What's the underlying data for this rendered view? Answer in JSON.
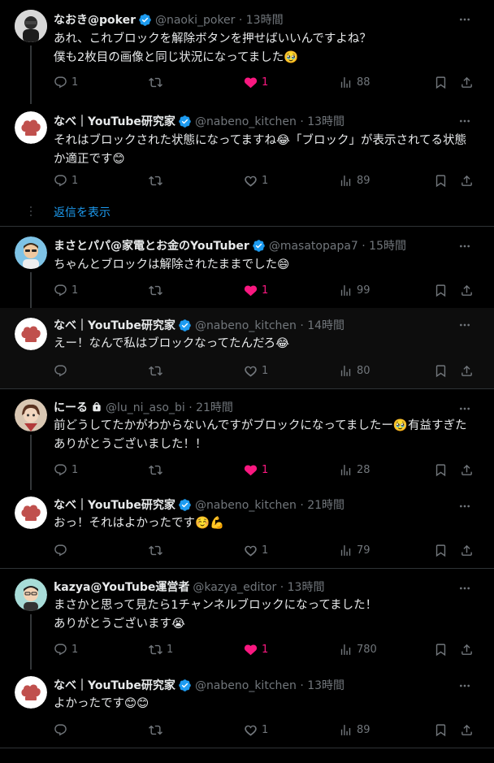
{
  "tweets": [
    {
      "name": "なおき@poker",
      "handle": "@naoki_poker · 13時間",
      "text": "あれ、これブロックを解除ボタンを押せばいいんですよね？\n僕も2枚目の画像と同じ状況になってました🥹",
      "replies": "1",
      "retweets": "",
      "likes": "1",
      "views": "88",
      "liked": true
    },
    {
      "name": "なべ｜YouTube研究家",
      "handle": "@nabeno_kitchen · 13時間",
      "text": "それはブロックされた状態になってますね😂「ブロック」が表示されてる状態か適正です😊",
      "replies": "1",
      "retweets": "",
      "likes": "1",
      "views": "89",
      "liked": false
    },
    {
      "name": "まさとパパ@家電とお金のYouTuber",
      "handle": "@masatopapa7 · 15時間",
      "text": "ちゃんとブロックは解除されたままでした😄",
      "replies": "1",
      "retweets": "",
      "likes": "1",
      "views": "99",
      "liked": true
    },
    {
      "name": "なべ｜YouTube研究家",
      "handle": "@nabeno_kitchen · 14時間",
      "text": "えー！なんで私はブロックなってたんだろ😂",
      "replies": "",
      "retweets": "",
      "likes": "1",
      "views": "80",
      "liked": false
    },
    {
      "name": "にーる",
      "handle": "@lu_ni_aso_bi · 21時間",
      "text": "前どうしてたかがわからないんですがブロックになってましたー🥹有益すぎたありがとうございました！！",
      "replies": "1",
      "retweets": "",
      "likes": "1",
      "views": "28",
      "liked": true
    },
    {
      "name": "なべ｜YouTube研究家",
      "handle": "@nabeno_kitchen · 21時間",
      "text": "おっ！それはよかったです☺️💪",
      "replies": "",
      "retweets": "",
      "likes": "1",
      "views": "79",
      "liked": false
    },
    {
      "name": "kazya@YouTube運営者",
      "handle": "@kazya_editor · 13時間",
      "text": "まさかと思って見たら1チャンネルブロックになってました！\nありがとうございます😭",
      "replies": "1",
      "retweets": "1",
      "likes": "1",
      "views": "780",
      "liked": true
    },
    {
      "name": "なべ｜YouTube研究家",
      "handle": "@nabeno_kitchen · 13時間",
      "text": "よかったです😊😊",
      "replies": "",
      "retweets": "",
      "likes": "1",
      "views": "89",
      "liked": false
    }
  ],
  "show_replies_label": "返信を表示",
  "colors": {
    "accent": "#1d9bf0",
    "like": "#f91880",
    "muted": "#71767b",
    "background": "#000000"
  },
  "icons": [
    "reply-icon",
    "retweet-icon",
    "like-icon",
    "views-icon",
    "bookmark-icon",
    "share-icon",
    "more-icon",
    "verified-icon",
    "lock-icon"
  ]
}
